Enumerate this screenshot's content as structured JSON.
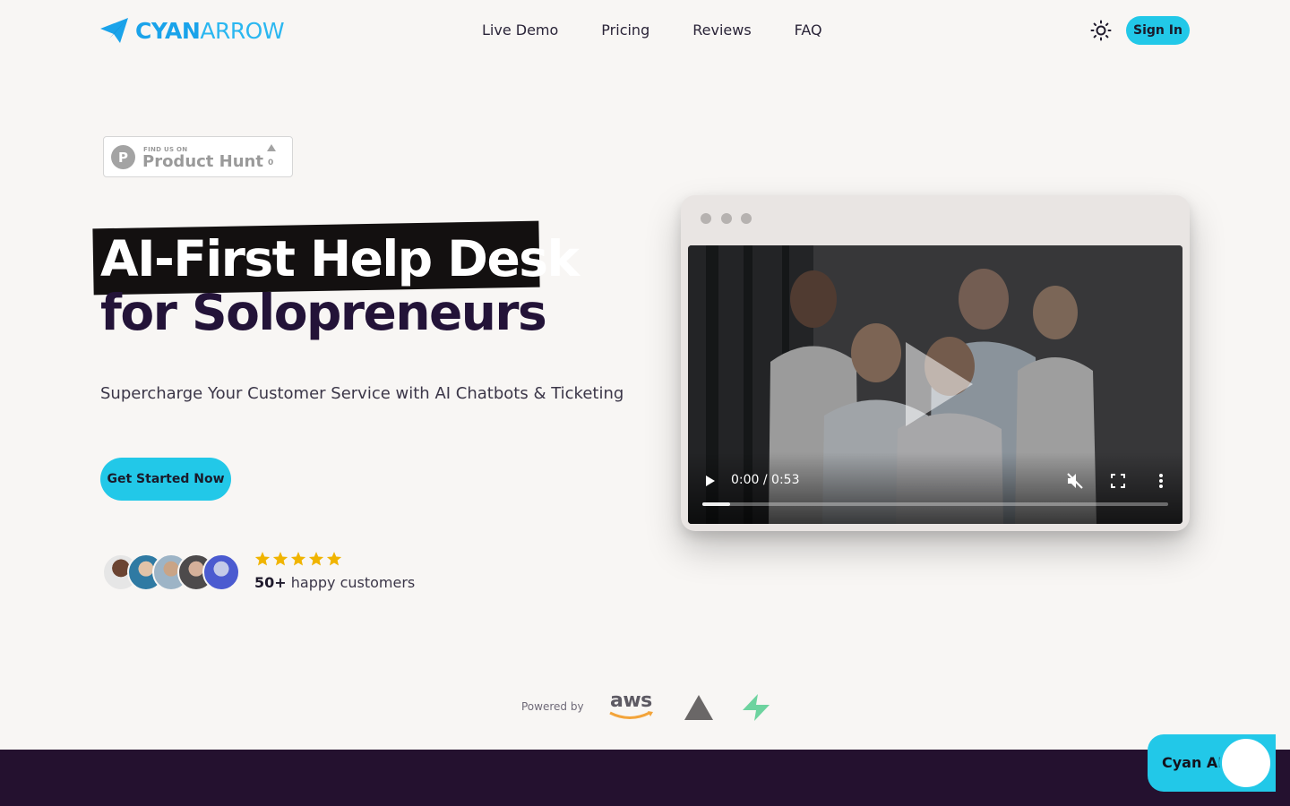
{
  "brand": {
    "name_part1": "CYAN",
    "name_part2": "ARROW",
    "color": "#1aa3ea",
    "icon": "paper-plane-arrow-icon"
  },
  "nav": {
    "items": [
      "Live Demo",
      "Pricing",
      "Reviews",
      "FAQ"
    ],
    "theme_icon": "sun-icon",
    "sign_in_label": "Sign In"
  },
  "product_hunt": {
    "small_text": "FIND US ON",
    "name": "Product Hunt",
    "votes": "0",
    "icon": "producthunt-logo-icon"
  },
  "hero": {
    "headline_line1": "AI-First Help Desk",
    "headline_line2": "for Solopreneurs",
    "subtitle": "Supercharge Your Customer Service with AI Chatbots & Ticketing",
    "cta_label": "Get Started Now"
  },
  "social_proof": {
    "avatars": [
      "customer-avatar-1",
      "customer-avatar-2",
      "customer-avatar-3",
      "customer-avatar-4",
      "customer-avatar-5"
    ],
    "rating": 5,
    "count": "50+",
    "count_suffix": "happy customers"
  },
  "video": {
    "time": "0:00 / 0:53",
    "progress": 0.06,
    "muted": true,
    "icons": [
      "play-icon",
      "muted-volume-icon",
      "fullscreen-icon",
      "more-options-icon"
    ]
  },
  "powered_by": {
    "label": "Powered by",
    "logos": [
      "aws",
      "vercel-triangle",
      "supabase-bolt"
    ],
    "aws_text": "aws"
  },
  "chat_widget": {
    "label": "Cyan AI"
  },
  "colors": {
    "accent": "#22c8e8",
    "dark": "#24112f",
    "background": "#f8f6f4"
  }
}
